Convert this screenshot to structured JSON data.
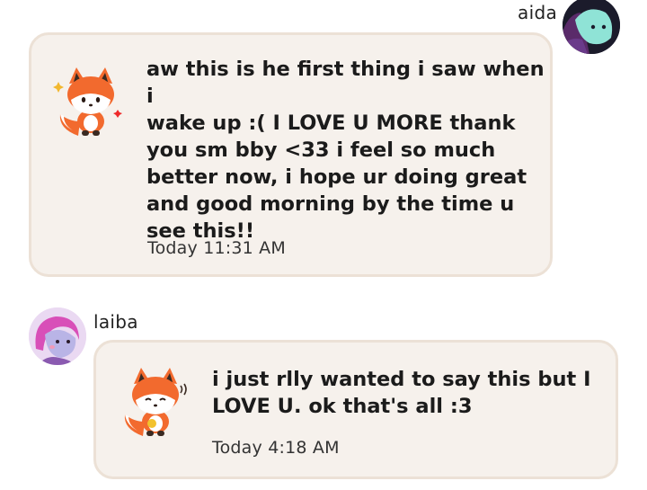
{
  "messages": [
    {
      "username": "aida",
      "sticker": "fox-sticker-icon",
      "text": "aw this is he first thing i saw when i\nwake up :( I LOVE U MORE thank\nyou sm bby <33 i feel so much\nbetter now, i hope ur doing great\nand good morning by the time u\nsee this!!",
      "timestamp": "Today 11:31 AM"
    },
    {
      "username": "laiba",
      "sticker": "fox-sticker-icon",
      "text": "i just rlly wanted to say this but I\nLOVE U. ok that's all :3",
      "timestamp": "Today 4:18 AM"
    }
  ],
  "colors": {
    "card_bg": "#f6f1ec",
    "card_border": "#ece1d6",
    "fox_orange": "#f26a2e"
  }
}
